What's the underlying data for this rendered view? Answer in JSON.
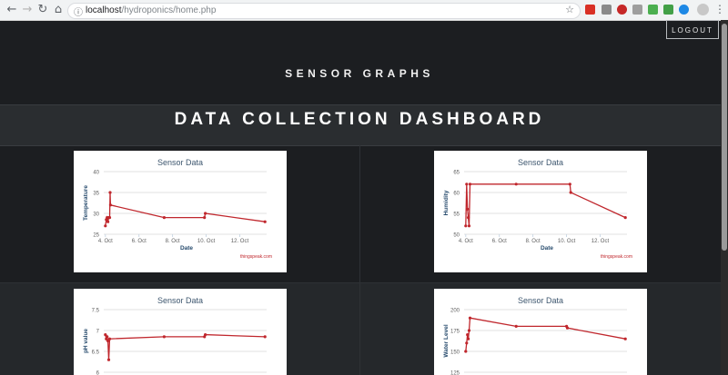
{
  "browser": {
    "url_host": "localhost",
    "url_path": "/hydroponics/home.php",
    "back_icon": "back-arrow-icon",
    "forward_icon": "forward-arrow-icon",
    "reload_icon": "reload-icon",
    "home_icon": "home-icon"
  },
  "header": {
    "logout_label": "LOGOUT",
    "section_title": "SENSOR GRAPHS",
    "dashboard_title": "DATA COLLECTION DASHBOARD"
  },
  "chart_data": [
    {
      "type": "line",
      "title": "Sensor Data",
      "xlabel": "Date",
      "ylabel": "Temperature",
      "credit": "thingspeak.com",
      "yticks": [
        "40",
        "35",
        "30",
        "25"
      ],
      "ylim": [
        25,
        40
      ],
      "xticks": [
        "4. Oct",
        "6. Oct",
        "8. Oct",
        "10. Oct",
        "12. Oct"
      ],
      "xtick_values": [
        4,
        6,
        8,
        10,
        12
      ],
      "xlim": [
        3.9,
        13.6
      ],
      "series": [
        {
          "points": [
            [
              4.0,
              27.0
            ],
            [
              4.05,
              28.5
            ],
            [
              4.1,
              29
            ],
            [
              4.15,
              28
            ],
            [
              4.2,
              29
            ],
            [
              4.25,
              29
            ],
            [
              4.28,
              35
            ],
            [
              4.3,
              32
            ],
            [
              7.5,
              29
            ],
            [
              9.9,
              29
            ],
            [
              9.95,
              30
            ],
            [
              13.5,
              28
            ]
          ]
        }
      ]
    },
    {
      "type": "line",
      "title": "Sensor Data",
      "xlabel": "Date",
      "ylabel": "Humidity",
      "credit": "thingspeak.com",
      "yticks": [
        "65",
        "60",
        "55",
        "50"
      ],
      "ylim": [
        50,
        65
      ],
      "xticks": [
        "4. Oct",
        "6. Oct",
        "8. Oct",
        "10. Oct",
        "12. Oct"
      ],
      "xtick_values": [
        4,
        6,
        8,
        10,
        12
      ],
      "xlim": [
        3.9,
        13.6
      ],
      "series": [
        {
          "points": [
            [
              4.0,
              52
            ],
            [
              4.05,
              62
            ],
            [
              4.1,
              56
            ],
            [
              4.15,
              54
            ],
            [
              4.2,
              52
            ],
            [
              4.25,
              62
            ],
            [
              7.0,
              62
            ],
            [
              10.2,
              62
            ],
            [
              10.25,
              60
            ],
            [
              13.5,
              54
            ]
          ]
        }
      ]
    },
    {
      "type": "line",
      "title": "Sensor Data",
      "xlabel": "",
      "ylabel": "pH value",
      "yticks": [
        "7.5",
        "7",
        "6.5",
        "6"
      ],
      "ylim": [
        6,
        7.5
      ],
      "xticks": [],
      "xtick_values": [],
      "xlim": [
        3.9,
        13.6
      ],
      "series": [
        {
          "points": [
            [
              4.0,
              6.9
            ],
            [
              4.05,
              6.8
            ],
            [
              4.1,
              6.85
            ],
            [
              4.15,
              6.75
            ],
            [
              4.2,
              6.3
            ],
            [
              4.25,
              6.8
            ],
            [
              7.5,
              6.85
            ],
            [
              9.9,
              6.85
            ],
            [
              9.95,
              6.9
            ],
            [
              13.5,
              6.85
            ]
          ]
        }
      ]
    },
    {
      "type": "line",
      "title": "Sensor Data",
      "xlabel": "",
      "ylabel": "Water Level",
      "yticks": [
        "200",
        "175",
        "150",
        "125"
      ],
      "ylim": [
        125,
        200
      ],
      "xticks": [],
      "xtick_values": [],
      "xlim": [
        3.9,
        13.6
      ],
      "series": [
        {
          "points": [
            [
              4.0,
              150
            ],
            [
              4.05,
              160
            ],
            [
              4.1,
              170
            ],
            [
              4.15,
              165
            ],
            [
              4.2,
              175
            ],
            [
              4.25,
              190
            ],
            [
              7.0,
              180
            ],
            [
              10.0,
              180
            ],
            [
              10.05,
              178
            ],
            [
              13.5,
              165
            ]
          ]
        }
      ]
    }
  ],
  "colors": {
    "line": "#c0272d",
    "title": "#3e576f",
    "axis_label": "#274b6d",
    "tick": "#606060",
    "grid": "#d8d8d8",
    "credit": "#c0272d"
  }
}
